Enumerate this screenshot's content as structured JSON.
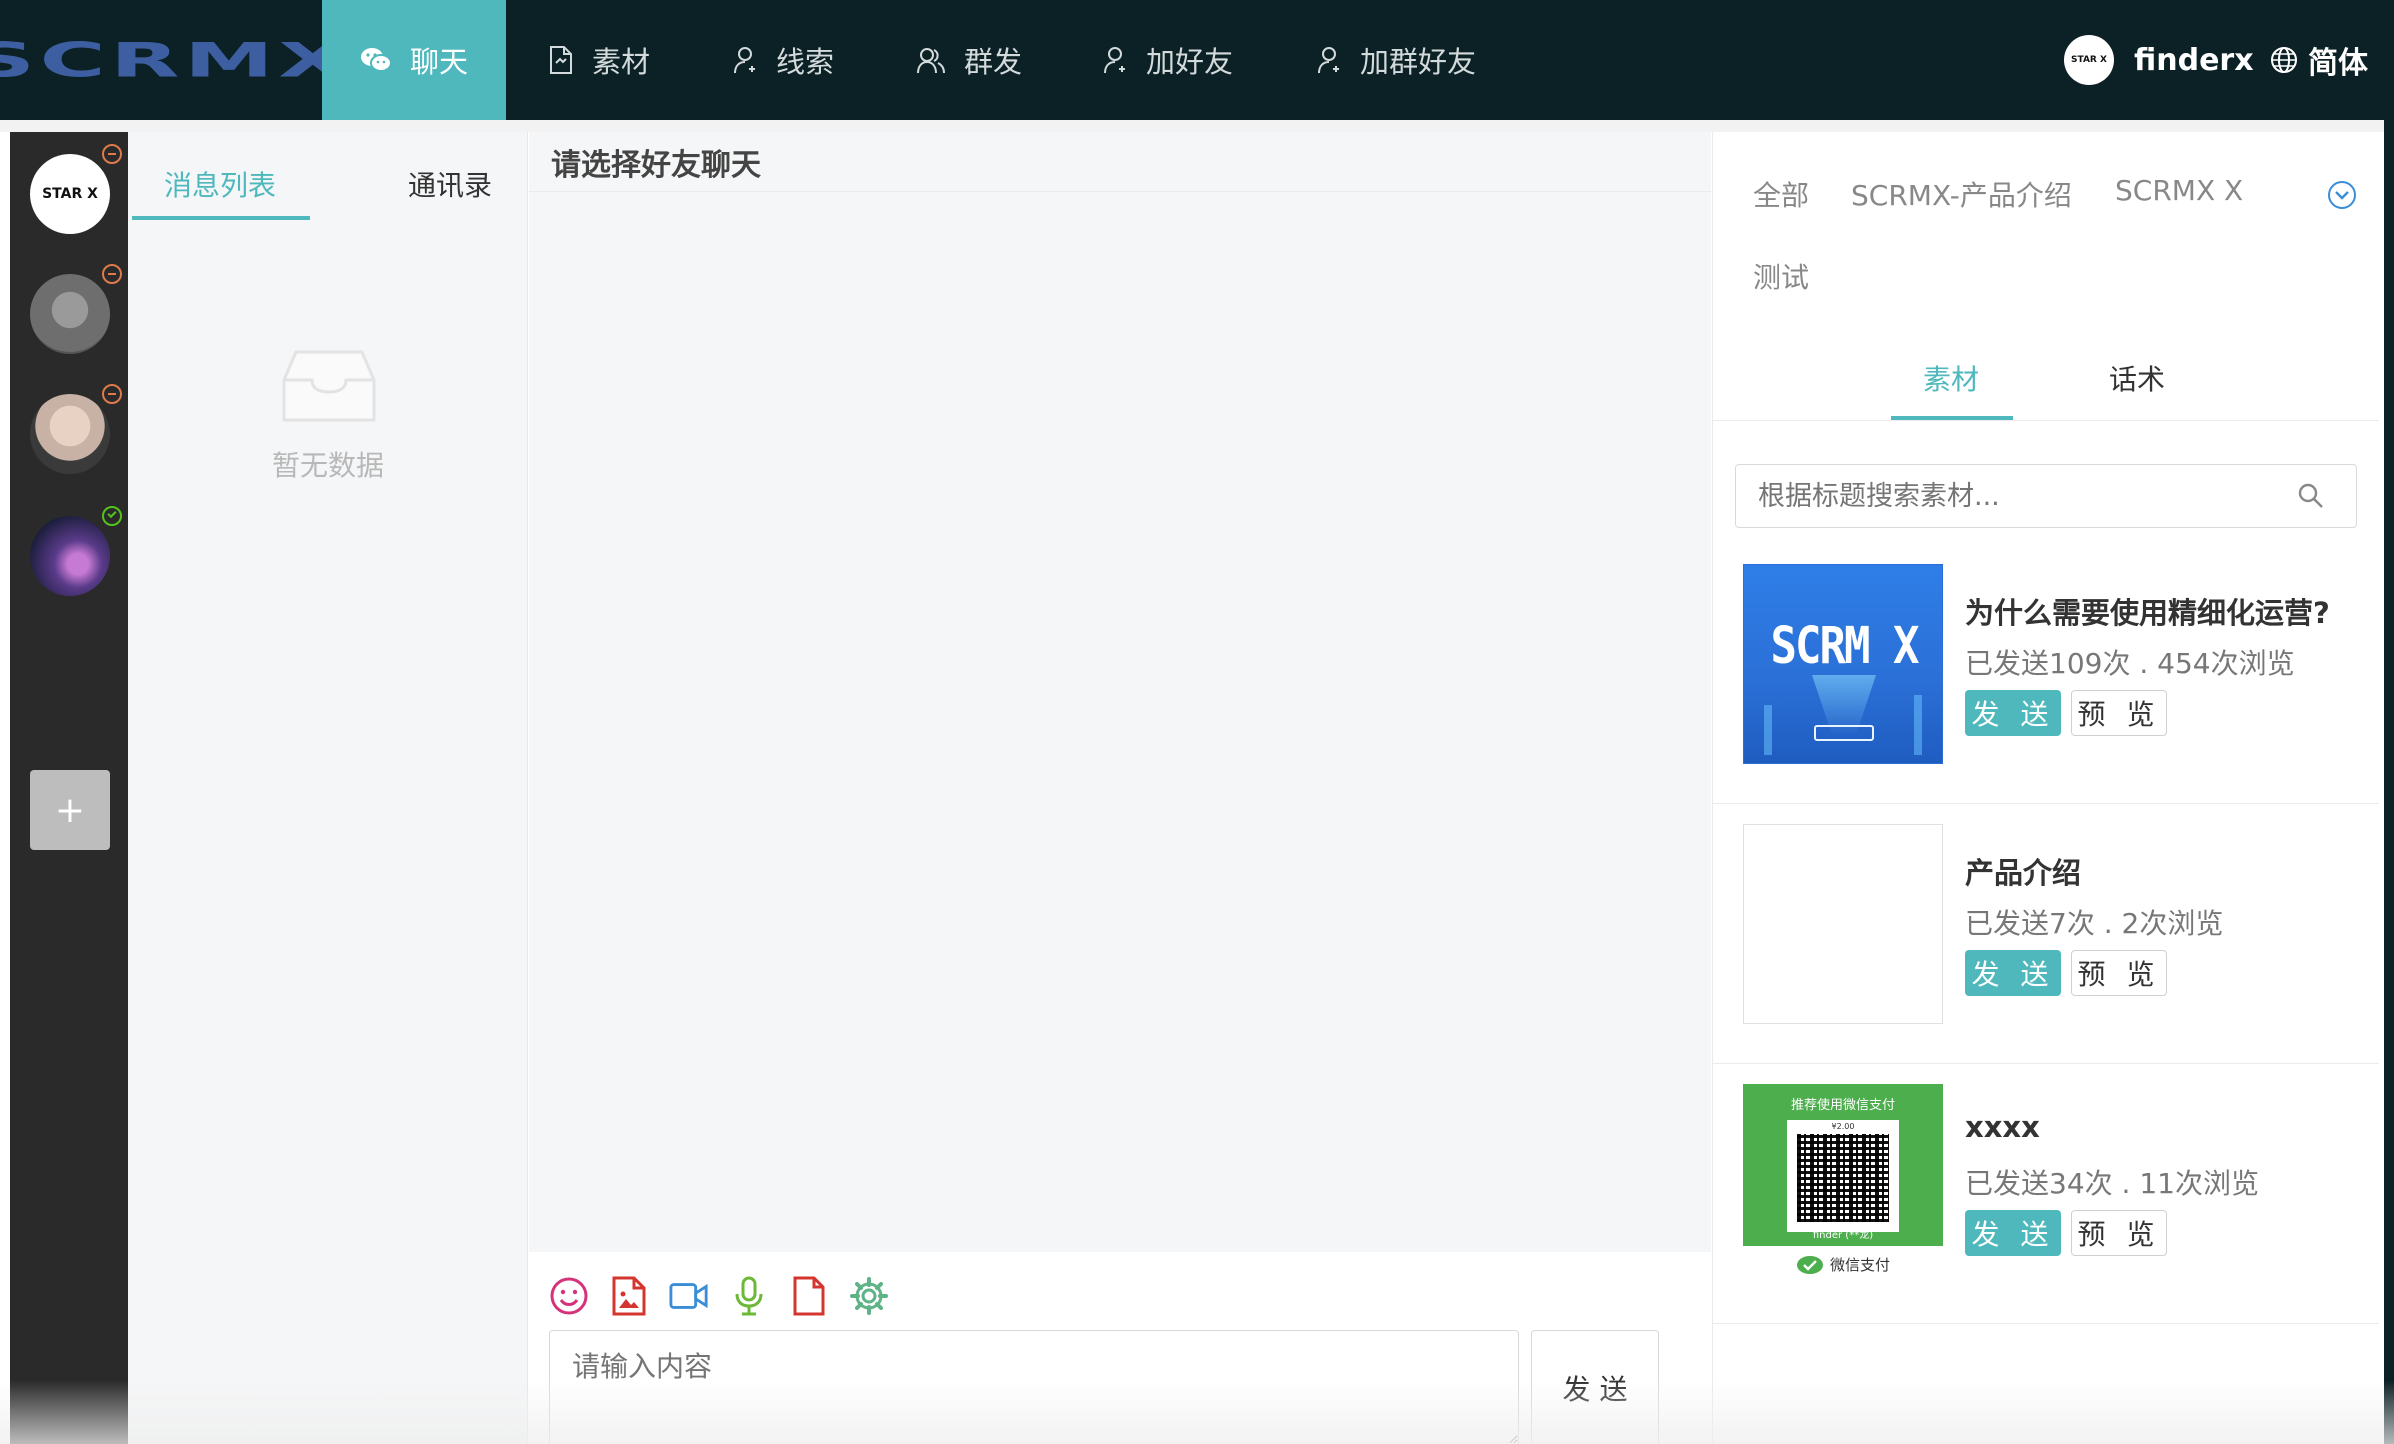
{
  "app": {
    "logo": "SCRMX"
  },
  "nav": {
    "items": [
      {
        "label": "聊天",
        "icon": "wechat-icon",
        "active": true
      },
      {
        "label": "素材",
        "icon": "document-icon"
      },
      {
        "label": "线索",
        "icon": "user-icon"
      },
      {
        "label": "群发",
        "icon": "users-icon"
      },
      {
        "label": "加好友",
        "icon": "add-user-icon"
      },
      {
        "label": "加群好友",
        "icon": "add-group-user-icon"
      }
    ],
    "user": {
      "avatar_text": "STAR X",
      "name": "finderx"
    },
    "language": "简体"
  },
  "accounts": {
    "first_avatar_text": "STAR X",
    "add_label": "+"
  },
  "contacts": {
    "tabs": [
      "消息列表",
      "通讯录"
    ],
    "empty_text": "暂无数据"
  },
  "chat": {
    "title": "请选择好友聊天",
    "input_placeholder": "请输入内容",
    "send_label": "发 送"
  },
  "materials": {
    "groups": [
      "全部",
      "SCRMX-产品介绍",
      "SCRMX X",
      "测试"
    ],
    "tabs": [
      "素材",
      "话术"
    ],
    "search_placeholder": "根据标题搜索素材...",
    "items": [
      {
        "title": "为什么需要使用精细化运营?",
        "stats": "已发送109次 . 454次浏览",
        "thumb_text": "SCRM X"
      },
      {
        "title": "产品介绍",
        "stats": "已发送7次 . 2次浏览"
      },
      {
        "title": "xxxx",
        "stats": "已发送34次 . 11次浏览",
        "thumb_top": "推荐使用微信支付",
        "thumb_amount": "¥2.00",
        "thumb_name": "finder (**龙)",
        "thumb_brand": "微信支付"
      }
    ],
    "send_label": "发 送",
    "preview_label": "预 览"
  },
  "colors": {
    "accent": "#4eb8bd",
    "topbar": "#0c2125",
    "logo": "#3d5ea0"
  }
}
